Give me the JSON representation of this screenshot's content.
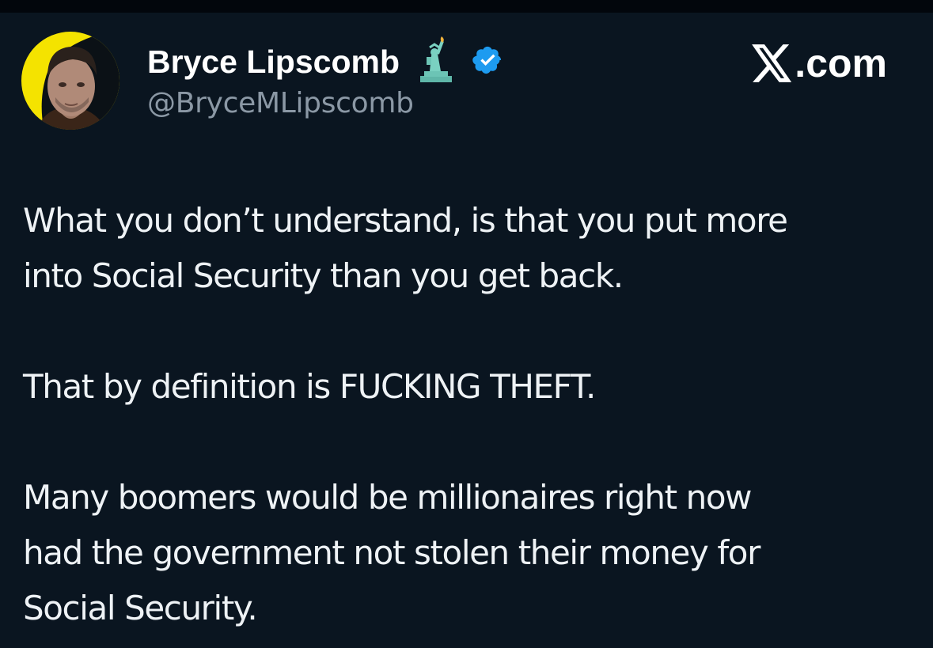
{
  "author": {
    "display_name": "Bryce Lipscomb",
    "handle": "@BryceMLipscomb",
    "name_emoji_icon": "statue-of-liberty-icon",
    "verified_icon": "verified-badge-icon",
    "verified_color": "#1d9bf0"
  },
  "watermark": {
    "logo_icon": "x-logo-icon",
    "text": ".com"
  },
  "tweet": {
    "paragraphs": [
      "What you don’t understand, is that you put more\ninto Social Security than you get back.",
      "That by definition is FUCKING THEFT.",
      "Many boomers would be millionaires right now\nhad the government not stolen their money for\nSocial Security."
    ]
  },
  "colors": {
    "background": "#0a1520",
    "text": "#eef2f5",
    "secondary_text": "#8b98a5",
    "avatar_ring": "#f4e300"
  }
}
